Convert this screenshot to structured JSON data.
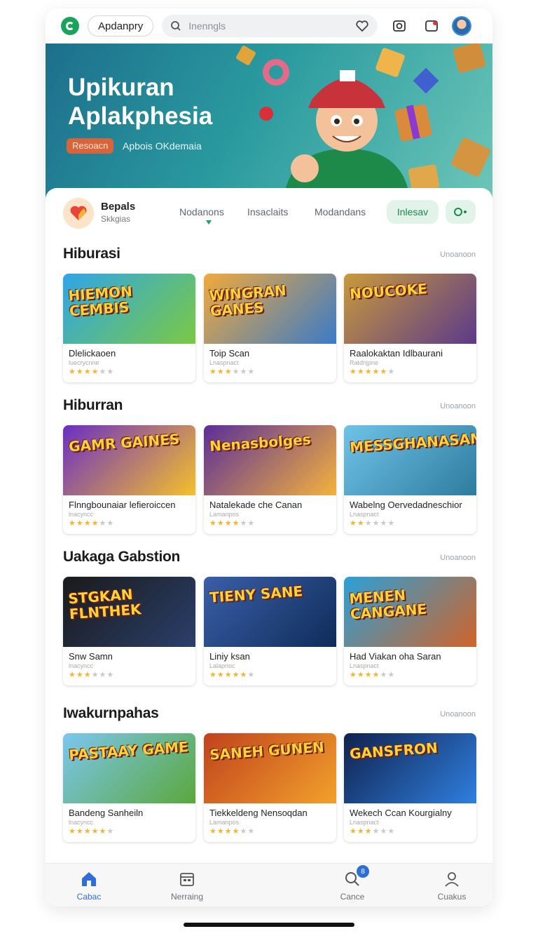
{
  "header": {
    "logo_icon": "app-logo-icon",
    "app_pill_label": "Apdanpry",
    "search_placeholder": "Inenngls",
    "icons": [
      "search-icon",
      "heart-icon",
      "camera-icon",
      "notification-icon",
      "user-avatar"
    ]
  },
  "banner": {
    "title": "Upikuran Aplakphesia",
    "tag_label": "Resoacn",
    "subtitle": "Apbois OKdemaia"
  },
  "filter": {
    "featured_title": "Bepals",
    "featured_sub": "Skkgias",
    "tabs": [
      "Nodanons",
      "Insaclaits",
      "Modandans"
    ],
    "active_chip": "Inlesav"
  },
  "sections": [
    {
      "title": "Hiburasi",
      "more": "Unoanoon",
      "cards": [
        {
          "title": "Dlelickaoen",
          "meta": "luecrycnne",
          "rating": 4,
          "thumb_text": "HIEMON CEMBIS",
          "colors": [
            "#2fa5e8",
            "#7ac943"
          ]
        },
        {
          "title": "Toip Scan",
          "meta": "Lnaspnact",
          "rating": 3,
          "thumb_text": "WINGRAN GANES",
          "colors": [
            "#f2a93b",
            "#3a7bc8"
          ]
        },
        {
          "title": "Raalokaktan Idlbaurani",
          "meta": "Ratdrijpne",
          "rating": 5,
          "thumb_text": "NOUCOKE",
          "colors": [
            "#c99a3a",
            "#5b3a8a"
          ]
        }
      ]
    },
    {
      "title": "Hiburran",
      "more": "Unoanoon",
      "cards": [
        {
          "title": "Flnngbounaiar lefieroiccen",
          "meta": "lnacyncc",
          "rating": 4,
          "thumb_text": "GAMR GAINES",
          "colors": [
            "#6a2ec4",
            "#f5c02b"
          ]
        },
        {
          "title": "Natalekade che Canan",
          "meta": "Lamanpos",
          "rating": 4,
          "thumb_text": "Nenasbolges",
          "colors": [
            "#5a2e9a",
            "#f3b23d"
          ]
        },
        {
          "title": "Wabelng Oervedadneschior",
          "meta": "Lnaspnact",
          "rating": 2,
          "thumb_text": "MESSGHANASAN",
          "colors": [
            "#6fc3e8",
            "#2e7c9e"
          ]
        }
      ]
    },
    {
      "title": "Uakaga Gabstion",
      "more": "Unoanoon",
      "cards": [
        {
          "title": "Snw Samn",
          "meta": "lnacyncc",
          "rating": 3,
          "thumb_text": "STGKAN FLNTHEK",
          "colors": [
            "#1a1a1a",
            "#2b3f6b"
          ]
        },
        {
          "title": "Liniy ksan",
          "meta": "Lalapnoc",
          "rating": 5,
          "thumb_text": "TIENY SANE",
          "colors": [
            "#3a5fa8",
            "#0f2c5a"
          ]
        },
        {
          "title": "Had Viakan oha Saran",
          "meta": "Lnaspnact",
          "rating": 4,
          "thumb_text": "MENEN CANGANE",
          "colors": [
            "#2aa0d8",
            "#d0642a"
          ]
        }
      ]
    },
    {
      "title": "Iwakurnpahas",
      "more": "Unoanoon",
      "cards": [
        {
          "title": "Bandeng Sanheiln",
          "meta": "lnacyncc",
          "rating": 5,
          "thumb_text": "PASTAAY GAME",
          "colors": [
            "#7cc6ef",
            "#5aa83c"
          ]
        },
        {
          "title": "Tiekkeldeng Nensoqdan",
          "meta": "Lamanpos",
          "rating": 4,
          "thumb_text": "SANEH GUNEN",
          "colors": [
            "#c0421e",
            "#f2a12b"
          ]
        },
        {
          "title": "Wekech Ccan Kourgialny",
          "meta": "Lnaspnact",
          "rating": 3,
          "thumb_text": "GANSFRON",
          "colors": [
            "#10224d",
            "#2f7fe0"
          ]
        }
      ]
    }
  ],
  "bottom_nav": [
    {
      "label": "Cabac",
      "icon": "home-icon",
      "active": true
    },
    {
      "label": "Nerraing",
      "icon": "calendar-icon",
      "active": false
    },
    {
      "label": "Cance",
      "icon": "search-icon",
      "active": false,
      "badge": "8"
    },
    {
      "label": "Cuakus",
      "icon": "profile-icon",
      "active": false
    }
  ],
  "colors": {
    "accent": "#1aa35a",
    "nav_active": "#2f6ed8",
    "banner_bg": "#2a9a9f"
  }
}
